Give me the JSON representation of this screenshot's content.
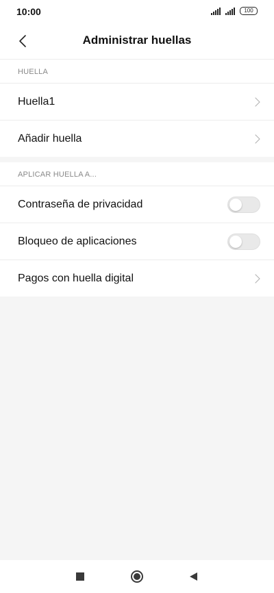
{
  "status_bar": {
    "time": "10:00",
    "battery": "100",
    "icons": [
      "signal-icon",
      "signal-icon",
      "battery-icon"
    ]
  },
  "header": {
    "title": "Administrar huellas",
    "back_icon": "chevron-left-icon"
  },
  "fingerprints": {
    "section_title": "HUELLA",
    "items": [
      {
        "label": "Huella1",
        "control": "chevron-right-icon"
      },
      {
        "label": "Añadir huella",
        "control": "chevron-right-icon"
      }
    ]
  },
  "apply": {
    "section_title": "APLICAR HUELLA A...",
    "items": [
      {
        "label": "Contraseña de privacidad",
        "control": "toggle",
        "enabled": false
      },
      {
        "label": "Bloqueo de aplicaciones",
        "control": "toggle",
        "enabled": false
      },
      {
        "label": "Pagos con huella digital",
        "control": "chevron-right-icon"
      }
    ]
  },
  "nav_bar": {
    "icons": [
      "square-recents-icon",
      "circle-home-icon",
      "triangle-back-icon"
    ]
  },
  "colors": {
    "background": "#f5f5f5",
    "surface": "#ffffff",
    "divider": "#ececec",
    "section_text": "#888888",
    "toggle_off": "#e9e9e9"
  }
}
